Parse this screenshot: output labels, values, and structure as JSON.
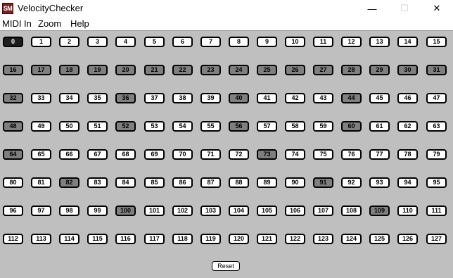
{
  "window": {
    "title": "VelocityChecker",
    "icon_text": "SM",
    "minimize_glyph": "—",
    "maximize_glyph": "☐",
    "close_glyph": "✕"
  },
  "menu": [
    {
      "label": "MIDI In"
    },
    {
      "label": "Zoom"
    },
    {
      "label": "Help"
    }
  ],
  "notes": {
    "count": 128,
    "columns": 16,
    "active": [
      0
    ],
    "hit": [
      16,
      17,
      18,
      19,
      20,
      21,
      22,
      23,
      24,
      25,
      26,
      27,
      28,
      29,
      30,
      31,
      32,
      36,
      40,
      44,
      48,
      52,
      56,
      60,
      64,
      73,
      82,
      91,
      100,
      109
    ]
  },
  "controls": {
    "reset_label": "Reset"
  },
  "colors": {
    "background": "#bfbfbf",
    "note_idle": "#ffffff",
    "note_hit": "#7f7f7f",
    "note_active": "#1e1e1e"
  }
}
